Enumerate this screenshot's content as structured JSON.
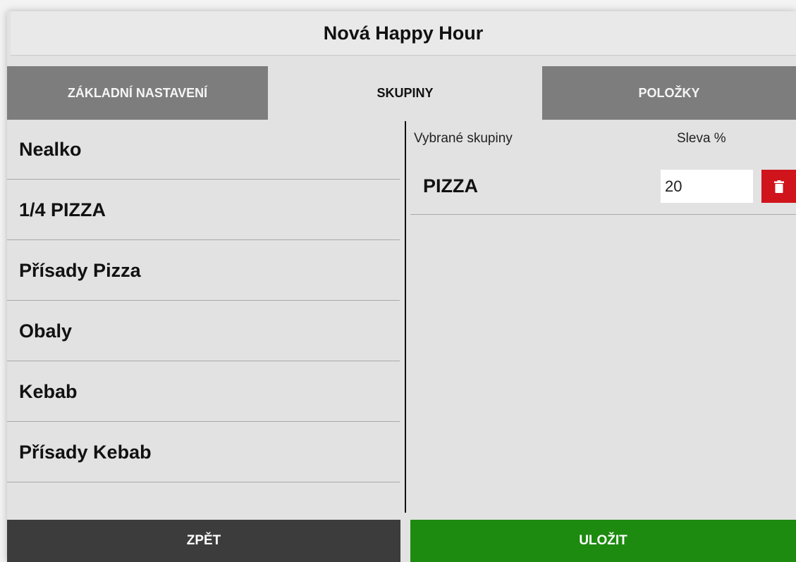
{
  "dialog": {
    "title": "Nová Happy Hour"
  },
  "tabs": [
    {
      "label": "ZÁKLADNÍ NASTAVENÍ",
      "active": false
    },
    {
      "label": "SKUPINY",
      "active": true
    },
    {
      "label": "POLOŽKY",
      "active": false
    }
  ],
  "groups": [
    {
      "label": "Nealko"
    },
    {
      "label": "1/4 PIZZA"
    },
    {
      "label": "Přísady Pizza"
    },
    {
      "label": "Obaly"
    },
    {
      "label": "Kebab"
    },
    {
      "label": "Přísady Kebab"
    }
  ],
  "selected": {
    "header_groups": "Vybrané skupiny",
    "header_discount": "Sleva %",
    "rows": [
      {
        "name": "PIZZA",
        "discount": "20",
        "delete_icon": "trash-icon"
      }
    ]
  },
  "footer": {
    "back_label": "ZPĚT",
    "save_label": "ULOŽIT"
  },
  "colors": {
    "tab_inactive": "#7d7d7d",
    "tab_active": "#e2e2e2",
    "delete": "#d0141c",
    "back": "#3c3c3c",
    "save": "#1d8a10"
  }
}
